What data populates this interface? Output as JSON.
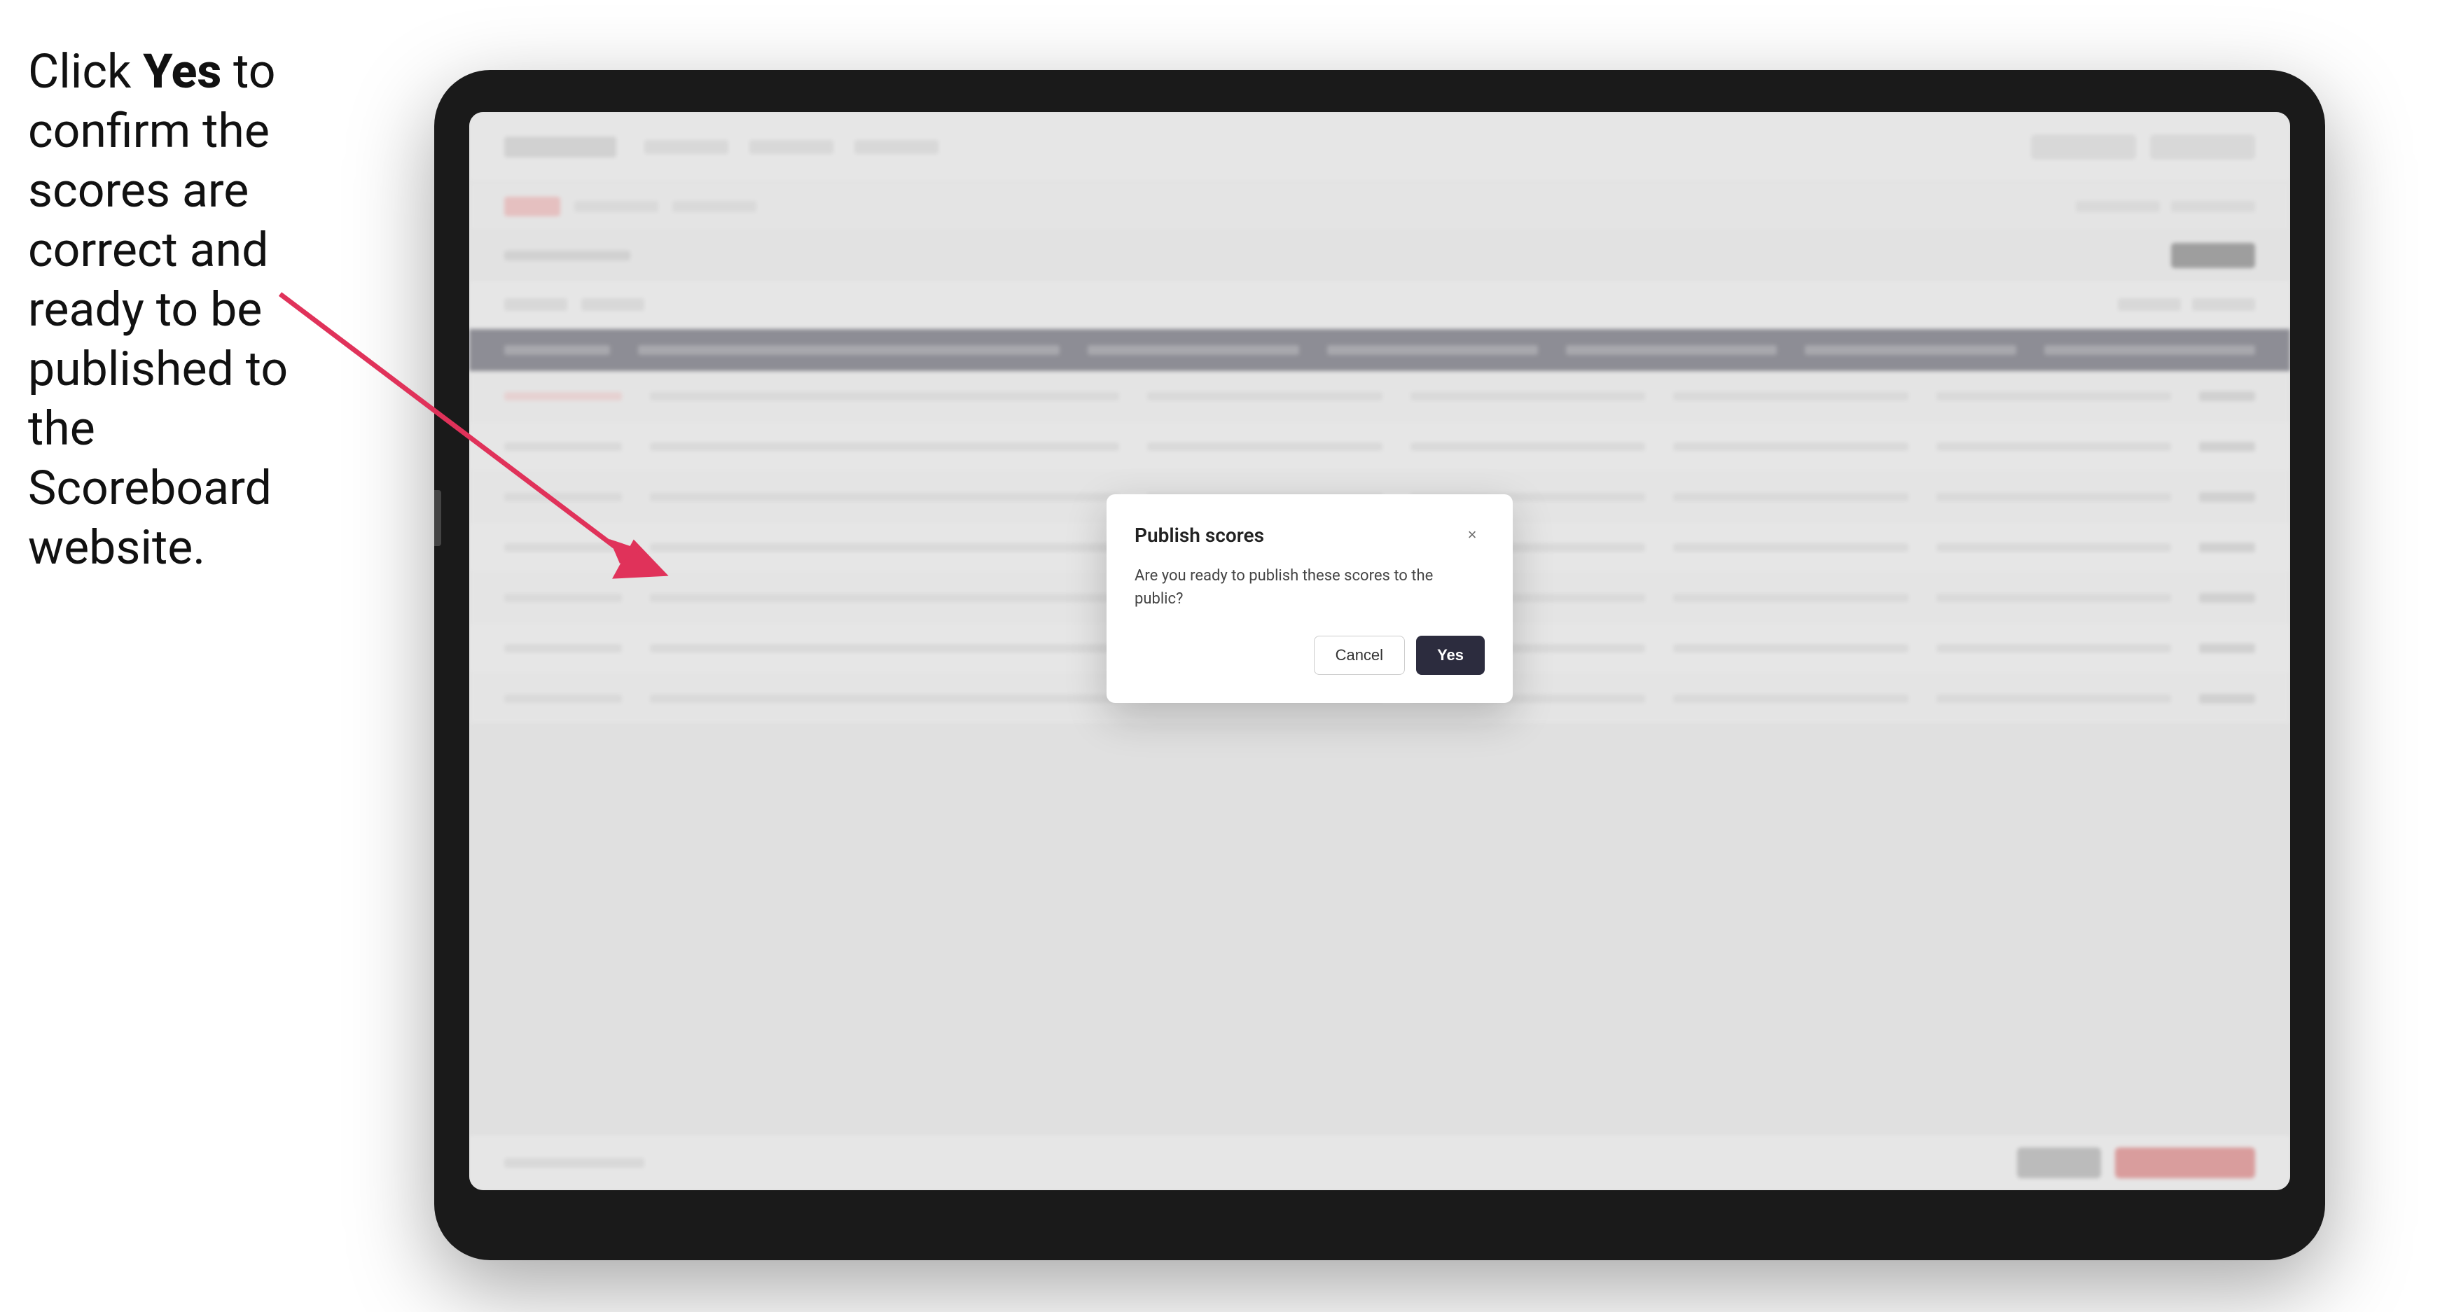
{
  "instruction": {
    "text_part1": "Click ",
    "bold_part": "Yes",
    "text_part2": " to confirm the scores are correct and ready to be published to the Scoreboard website."
  },
  "modal": {
    "title": "Publish scores",
    "body_text": "Are you ready to publish these scores to the public?",
    "cancel_label": "Cancel",
    "yes_label": "Yes",
    "close_icon": "×"
  },
  "table": {
    "rows": [
      {
        "id": "row1"
      },
      {
        "id": "row2"
      },
      {
        "id": "row3"
      },
      {
        "id": "row4"
      },
      {
        "id": "row5"
      },
      {
        "id": "row6"
      },
      {
        "id": "row7"
      }
    ]
  }
}
